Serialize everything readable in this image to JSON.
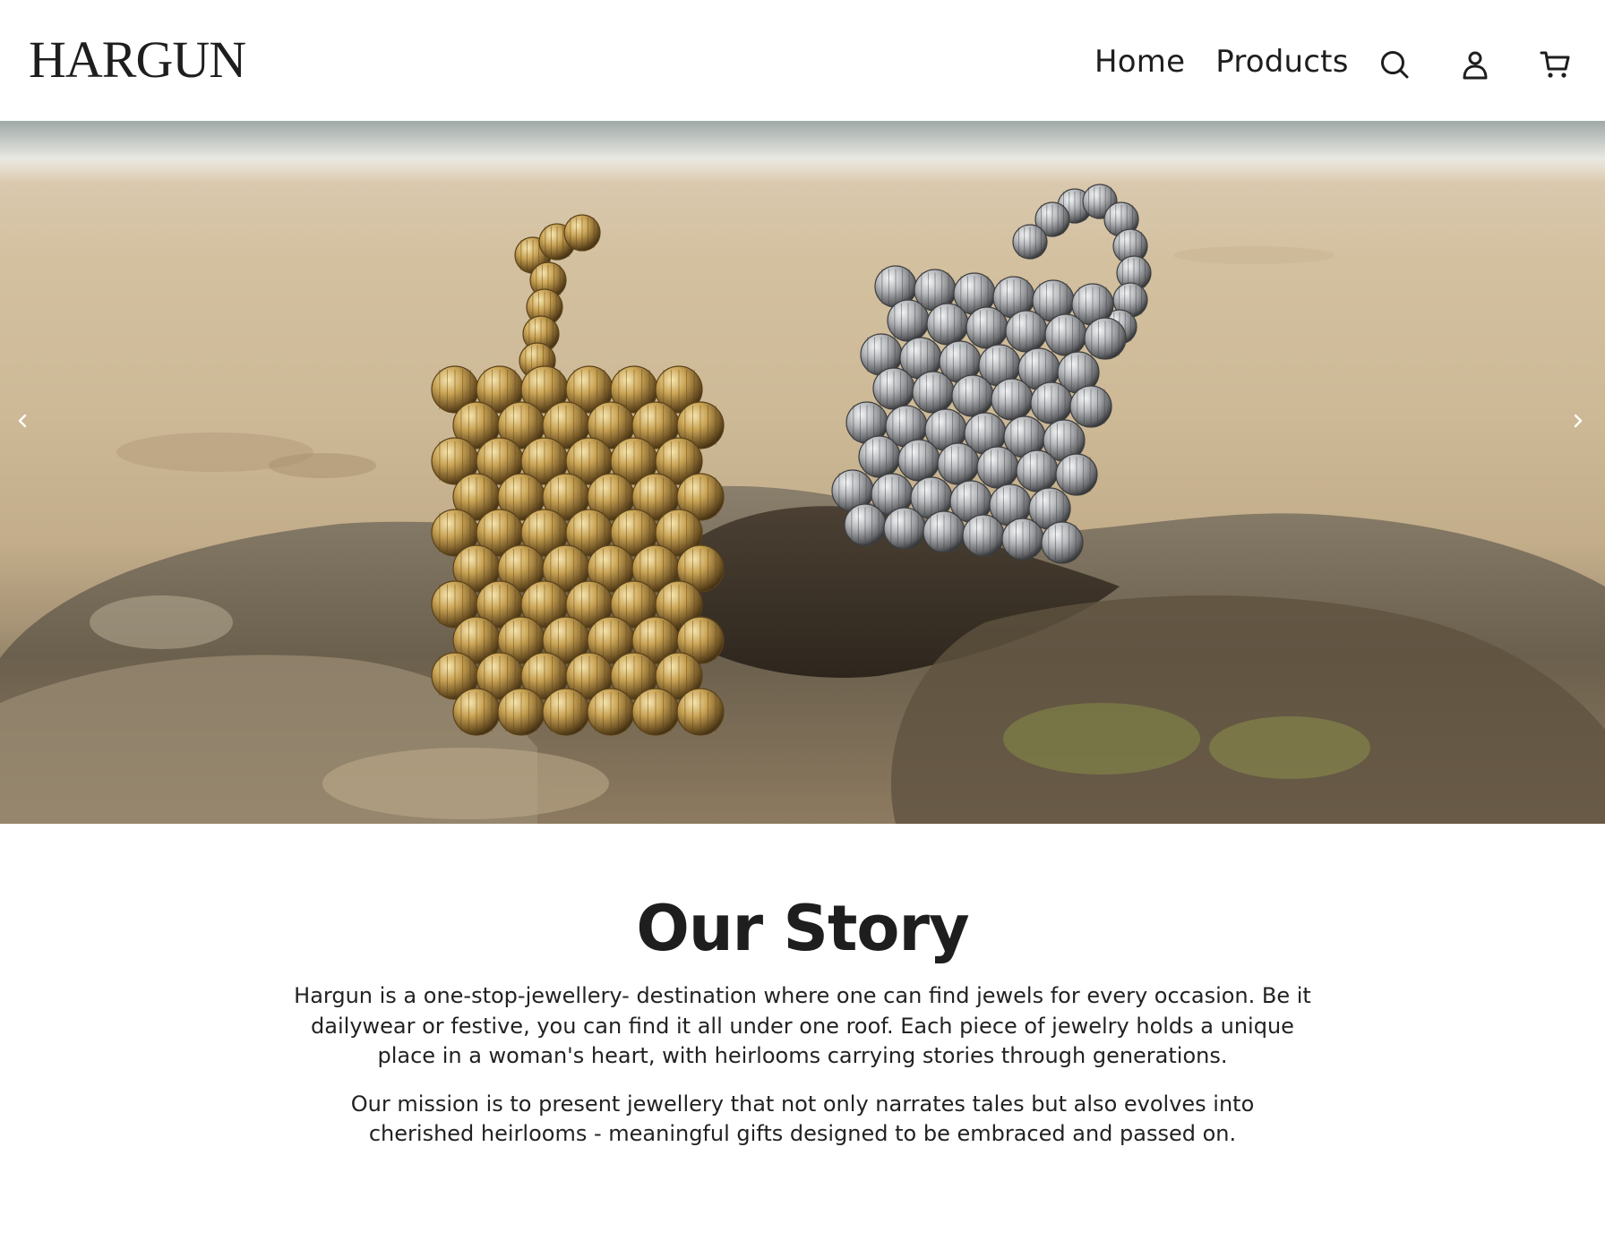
{
  "header": {
    "logo": "HARGUN",
    "nav": [
      {
        "label": "Home"
      },
      {
        "label": "Products"
      }
    ],
    "icons": [
      "search-icon",
      "account-icon",
      "cart-icon"
    ]
  },
  "hero": {
    "prev_icon": "chevron-left-icon",
    "next_icon": "chevron-right-icon"
  },
  "story": {
    "title": "Our Story",
    "paragraphs": [
      "Hargun is a one-stop-jewellery- destination where one can find jewels for every occasion. Be it dailywear or festive, you can find it all under one roof. Each piece of jewelry holds a unique place in a woman's heart, with heirlooms carrying stories through generations.",
      "Our mission is to present jewellery that not only narrates tales but also evolves into cherished heirlooms - meaningful gifts designed to be embraced and passed on."
    ]
  },
  "colors": {
    "text": "#1e1e1e",
    "background": "#ffffff",
    "gold": "#b58f3c",
    "silver": "#a9abae"
  }
}
